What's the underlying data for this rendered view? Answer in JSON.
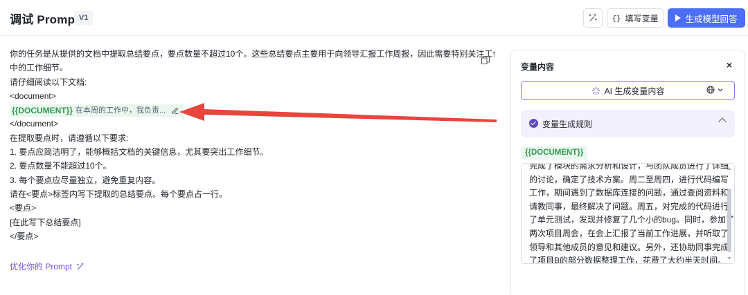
{
  "header": {
    "title": "调试 Prompt",
    "version": "V1",
    "fill_vars_brace": "{}",
    "fill_vars_label": "填写变量",
    "generate_label": "生成模型回答"
  },
  "prompt": {
    "lines": [
      "你的任务是从提供的文档中提取总结要点，要点数量不超过10个。这些总结要点主要用于向领导汇报工作周报，因此需要特别关注工作",
      "中的工作细节。",
      "请仔细阅读以下文档:",
      "<document>",
      null,
      "</document>",
      "在提取要点时，请遵循以下要求:",
      "1. 要点应简洁明了，能够概括文档的关键信息，尤其要突出工作细节。",
      "2. 要点数量不能超过10个。",
      "3. 每个要点应尽量独立，避免重复内容。",
      "请在<要点>标签内写下提取的总结要点。每个要点占一行。",
      "<要点>",
      "[在此写下总结要点]",
      "</要点>"
    ],
    "variable_name": "{{DOCUMENT}}",
    "variable_preview": "在本周的工作中，我负责...",
    "optimize_label": "优化你的 Prompt"
  },
  "panel": {
    "title": "变量内容",
    "close": "×",
    "ai_generate_label": "AI 生成变量内容",
    "rule_label": "变量生成规则",
    "doc_tag": "{{DOCUMENT}}",
    "content_lines": [
      "完成了模块的需求分析和设计，与团队成员进行了详细",
      "的讨论，确定了技术方案。周二至周四，进行代码编写",
      "工作，期间遇到了数据库连接的问题，通过查阅资料和",
      "请教同事，最终解决了问题。周五，对完成的代码进行",
      "了单元测试，发现并修复了几个小的bug。同时，参加了",
      "两次项目周会，在会上汇报了当前工作进展，并听取了",
      "领导和其他成员的意见和建议。另外，还协助同事完成",
      "了项目B的部分数据整理工作，花费了大约半天时间。"
    ]
  },
  "colors": {
    "primary": "#4c6ef5",
    "variable_green": "#2e9b4f",
    "accent_purple": "#7b4fd6",
    "arrow_red": "#e8453c"
  }
}
